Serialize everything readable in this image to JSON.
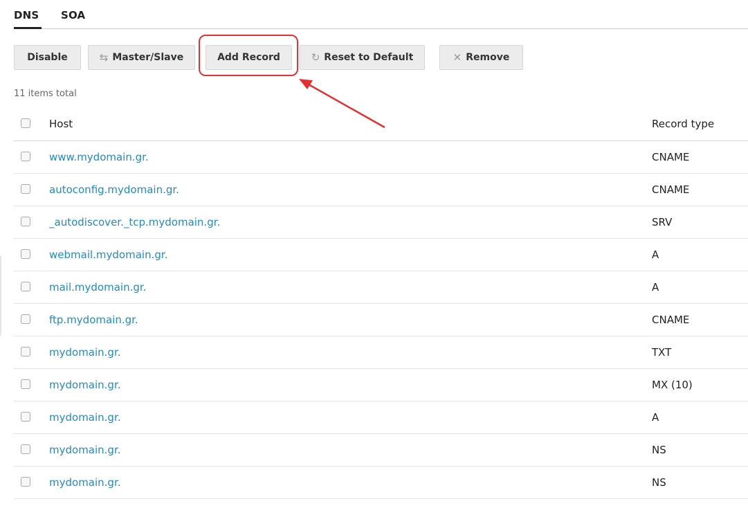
{
  "tabs": [
    {
      "label": "DNS",
      "active": true
    },
    {
      "label": "SOA",
      "active": false
    }
  ],
  "toolbar": {
    "disable_label": "Disable",
    "master_slave_label": "Master/Slave",
    "add_record_label": "Add Record",
    "reset_label": "Reset to Default",
    "remove_label": "Remove"
  },
  "icons": {
    "master_slave": "link-swap-icon",
    "reset": "refresh-icon",
    "remove": "remove-x-icon"
  },
  "colors": {
    "link": "#1f8bc4",
    "highlight": "#e53030",
    "button_bg": "#ececec"
  },
  "summary": {
    "items_total": "11 items total"
  },
  "table": {
    "headers": {
      "host": "Host",
      "record_type": "Record type"
    },
    "rows": [
      {
        "host": "www.mydomain.gr.",
        "type": "CNAME"
      },
      {
        "host": "autoconfig.mydomain.gr.",
        "type": "CNAME"
      },
      {
        "host": "_autodiscover._tcp.mydomain.gr.",
        "type": "SRV"
      },
      {
        "host": "webmail.mydomain.gr.",
        "type": "A"
      },
      {
        "host": "mail.mydomain.gr.",
        "type": "A"
      },
      {
        "host": "ftp.mydomain.gr.",
        "type": "CNAME"
      },
      {
        "host": "mydomain.gr.",
        "type": "TXT"
      },
      {
        "host": "mydomain.gr.",
        "type": "MX (10)"
      },
      {
        "host": "mydomain.gr.",
        "type": "A"
      },
      {
        "host": "mydomain.gr.",
        "type": "NS"
      },
      {
        "host": "mydomain.gr.",
        "type": "NS"
      }
    ]
  }
}
